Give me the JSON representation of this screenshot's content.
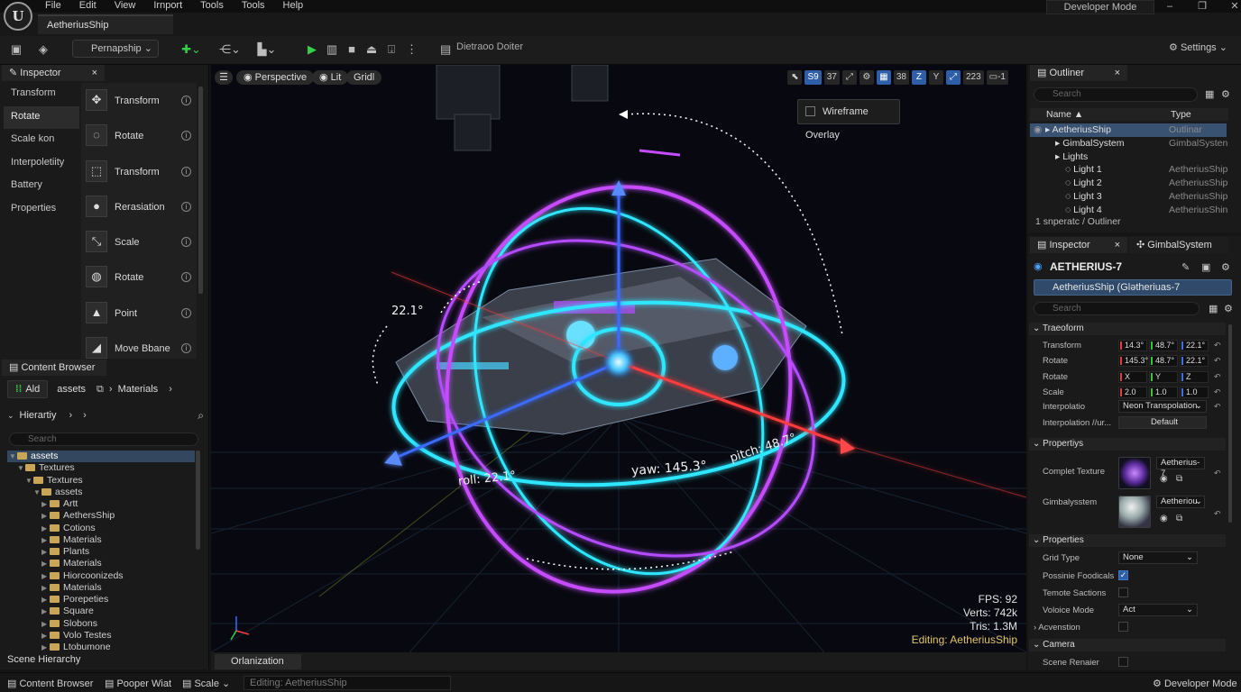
{
  "app": {
    "logo": "U",
    "document_tab": "AetheriusShip"
  },
  "menu": [
    "File",
    "Edit",
    "View",
    "Irnport",
    "Tools",
    "Tools",
    "Help"
  ],
  "window": {
    "developer_mode": "Developer Mode",
    "controls": [
      "–",
      "❐",
      "✕"
    ]
  },
  "toolbar": {
    "mode_dropdown": "Pernapship",
    "hint": "Dietraoo Doiter",
    "settings": "Settings"
  },
  "left_inspector": {
    "tab": "Inspector",
    "categories": [
      "Transform",
      "Rotate",
      "Scale kon",
      "Interpoletiity",
      "Battery",
      "Properties"
    ],
    "tools": [
      {
        "label": "Transform",
        "icon": "move-icon"
      },
      {
        "label": "Rotate",
        "icon": "rotate-icon"
      },
      {
        "label": "Transform",
        "icon": "transform-icon"
      },
      {
        "label": "Rerasiation",
        "icon": "light-bulb-icon"
      },
      {
        "label": "Scale",
        "icon": "scale-icon"
      },
      {
        "label": "Rotate",
        "icon": "sphere-icon"
      },
      {
        "label": "Point",
        "icon": "point-icon"
      },
      {
        "label": "Move Bbane",
        "icon": "move-plane-icon"
      }
    ]
  },
  "content_browser": {
    "tab": "Content Browser",
    "add_label": "Ald",
    "path": [
      "assets",
      "Materials"
    ],
    "hierarchy_label": "Hierartiy",
    "search_placeholder": "Search",
    "tree": [
      {
        "label": "assets",
        "depth": 0,
        "selected": true
      },
      {
        "label": "Textures",
        "depth": 1
      },
      {
        "label": "Textures",
        "depth": 2
      },
      {
        "label": "assets",
        "depth": 3
      },
      {
        "label": "Artt",
        "depth": 4
      },
      {
        "label": "AethersShip",
        "depth": 4
      },
      {
        "label": "Cotions",
        "depth": 4
      },
      {
        "label": "Materials",
        "depth": 4
      },
      {
        "label": "Plants",
        "depth": 4
      },
      {
        "label": "Materials",
        "depth": 4
      },
      {
        "label": "Hiorcoonizeds",
        "depth": 4
      },
      {
        "label": "Materials",
        "depth": 4
      },
      {
        "label": "Porepeties",
        "depth": 4
      },
      {
        "label": "Square",
        "depth": 4
      },
      {
        "label": "Slobons",
        "depth": 4
      },
      {
        "label": "Volo Testes",
        "depth": 4
      },
      {
        "label": "Ltobumone",
        "depth": 4
      }
    ],
    "scene_hierarchy": "Scene Hierarchy"
  },
  "viewport": {
    "perspective": "Perspective",
    "lit": "Lit",
    "grid": "Gridl",
    "tools": [
      {
        "t": "⬉",
        "blue": false
      },
      {
        "t": "S9",
        "blue": true
      },
      {
        "t": "37",
        "blue": false
      },
      {
        "t": "⤢",
        "blue": false
      },
      {
        "t": "⚙",
        "blue": false
      },
      {
        "t": "▦",
        "blue": true
      },
      {
        "t": "38",
        "blue": false
      },
      {
        "t": "Z",
        "blue": true
      },
      {
        "t": "Y",
        "blue": false
      },
      {
        "t": "⤢",
        "blue": true
      },
      {
        "t": "223",
        "blue": false
      },
      {
        "t": "▭-1",
        "blue": false
      }
    ],
    "wireframe_overlay": "Wireframe Overlay",
    "angles": {
      "top": "22.1°",
      "roll": "roll: 22.1°",
      "yaw": "yaw: 145.3°",
      "pitch": "pitch: 48.7°"
    },
    "stats": {
      "fps": "FPS: 92",
      "verts": "Verts: 742k",
      "tris": "Tris: 1.3M",
      "editing": "Editing: AetheriusShip"
    },
    "bottom_tab": "Orlanization",
    "colors": {
      "cyan": "#2ee6ff",
      "magenta": "#c64bff",
      "violet": "#7a5cff",
      "red": "#ff3a3a",
      "blue": "#3a6bff"
    }
  },
  "outliner": {
    "tab": "Outliner",
    "search_placeholder": "Search",
    "columns": {
      "name": "Name ▲",
      "type": "Type"
    },
    "rows": [
      {
        "name": "AetheriusShip",
        "type": "Outlinar",
        "indent": 1,
        "selected": true
      },
      {
        "name": "GimbalSystem",
        "type": "GimbalSysten",
        "indent": 2
      },
      {
        "name": "Lights",
        "type": "",
        "indent": 2
      },
      {
        "name": "Light 1",
        "type": "AetheriusShip",
        "indent": 3
      },
      {
        "name": "Light 2",
        "type": "AetheriusShip",
        "indent": 3
      },
      {
        "name": "Light 3",
        "type": "AetheriusShip",
        "indent": 3
      },
      {
        "name": "Light 4",
        "type": "AetheriusShin",
        "indent": 3
      }
    ],
    "footer": "1 snperatc / Outliner"
  },
  "inspector": {
    "tab": "Inspector",
    "tab2": "GimbalSystem",
    "object_name": "AETHERIUS-7",
    "object_sub": "AetheriusShip (Glətheriuas-7",
    "search_placeholder": "Search",
    "transform_section": "Traeoform",
    "transform_rows": [
      {
        "label": "Transform",
        "values": [
          "14.3°",
          "48.7°",
          "22.1°"
        ]
      },
      {
        "label": "Rotate",
        "values": [
          "145.3°",
          "48.7°",
          "22.1°"
        ]
      },
      {
        "label": "Rotate",
        "values": [
          "X",
          "Y",
          "Z"
        ]
      },
      {
        "label": "Scale",
        "values": [
          "2.0",
          "1.0",
          "1.0"
        ]
      }
    ],
    "interpolation_label": "Interpolatio",
    "interpolation_value": "Neon Transpolation",
    "interpolation2_label": "Interpolation //ur...",
    "interpolation2_value": "Default",
    "props_section": "Propertiys",
    "complet_texture_label": "Complet Texture",
    "complet_texture_value": "Aetherius-7",
    "gimbal_label": "Gimbalysstem",
    "gimbal_value": "Aetheriou",
    "props2_section": "Properties",
    "grid_type_label": "Grid Type",
    "grid_type_value": "None",
    "possible_label": "Possinie Foodicals",
    "temote_label": "Temote Sactions",
    "voloice_label": "Voloice Mode",
    "voloice_value": "Act",
    "acvenstion_label": "Acvenstion",
    "camera_section": "Camera",
    "scene_render_label": "Scene Renaier"
  },
  "statusbar": {
    "content_browser": "Content Browser",
    "pooper": "Pooper Wiat",
    "scale": "Scale",
    "editing": "Editing: AetheriusShip",
    "developer_mode": "Developer Mode"
  }
}
